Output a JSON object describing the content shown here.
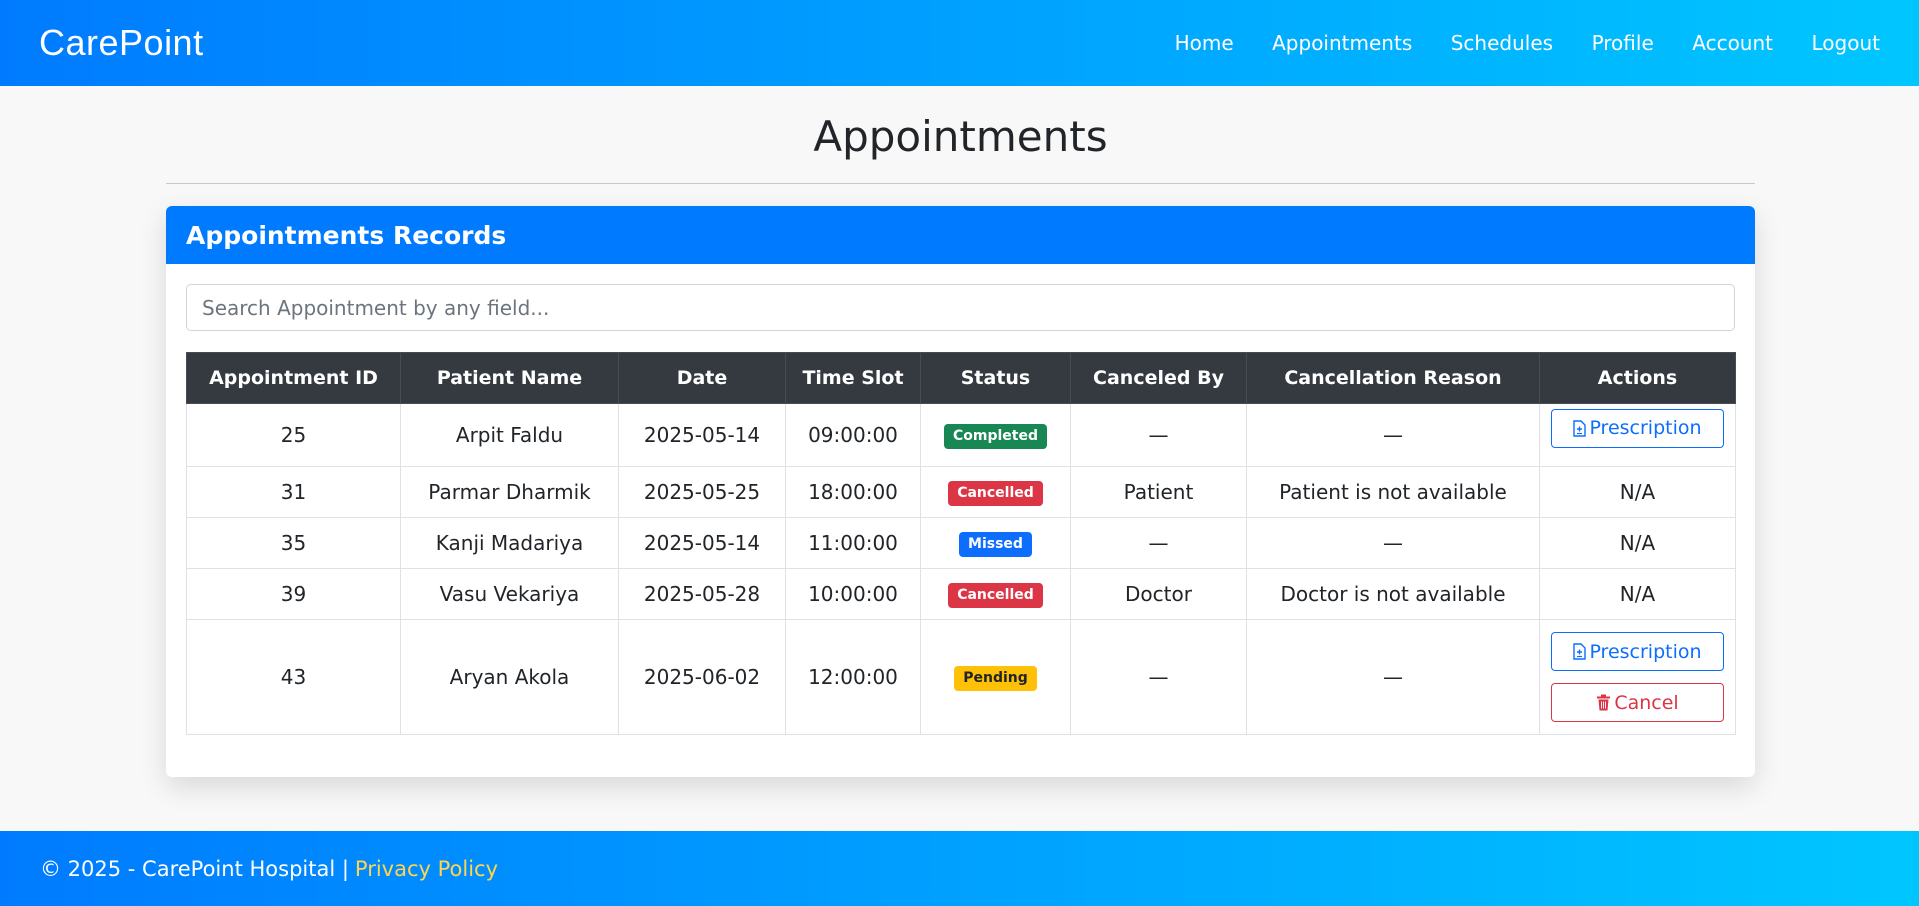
{
  "nav": {
    "brand": "CarePoint",
    "links": [
      "Home",
      "Appointments",
      "Schedules",
      "Profile",
      "Account",
      "Logout"
    ]
  },
  "page": {
    "title": "Appointments"
  },
  "card": {
    "header": "Appointments Records",
    "search_placeholder": "Search Appointment by any field..."
  },
  "table": {
    "columns": [
      "Appointment ID",
      "Patient Name",
      "Date",
      "Time Slot",
      "Status",
      "Canceled By",
      "Cancellation Reason",
      "Actions"
    ],
    "rows": [
      {
        "id": "25",
        "patient": "Arpit Faldu",
        "date": "2025-05-14",
        "time": "09:00:00",
        "status": "Completed",
        "canceled_by": "—",
        "reason": "—",
        "action_na": "",
        "prescription": "Prescription",
        "cancel": ""
      },
      {
        "id": "31",
        "patient": "Parmar Dharmik",
        "date": "2025-05-25",
        "time": "18:00:00",
        "status": "Cancelled",
        "canceled_by": "Patient",
        "reason": "Patient is not available",
        "action_na": "N/A",
        "prescription": "",
        "cancel": ""
      },
      {
        "id": "35",
        "patient": "Kanji Madariya",
        "date": "2025-05-14",
        "time": "11:00:00",
        "status": "Missed",
        "canceled_by": "—",
        "reason": "—",
        "action_na": "N/A",
        "prescription": "",
        "cancel": ""
      },
      {
        "id": "39",
        "patient": "Vasu Vekariya",
        "date": "2025-05-28",
        "time": "10:00:00",
        "status": "Cancelled",
        "canceled_by": "Doctor",
        "reason": "Doctor is not available",
        "action_na": "N/A",
        "prescription": "",
        "cancel": ""
      },
      {
        "id": "43",
        "patient": "Aryan Akola",
        "date": "2025-06-02",
        "time": "12:00:00",
        "status": "Pending",
        "canceled_by": "—",
        "reason": "—",
        "action_na": "",
        "prescription": "Prescription",
        "cancel": "Cancel"
      }
    ]
  },
  "footer": {
    "copyright": "© 2025 - CarePoint Hospital |",
    "link": "Privacy Policy"
  },
  "colors": {
    "primary": "#007bff",
    "gradient_end": "#00c6ff",
    "table_header": "#343a40",
    "completed": "#198754",
    "cancelled": "#dc3545",
    "missed": "#0d6efd",
    "pending": "#ffc107",
    "footer_link": "#ffd54f"
  },
  "icons": {
    "prescription": "file-medical-icon",
    "cancel": "trash-icon"
  }
}
